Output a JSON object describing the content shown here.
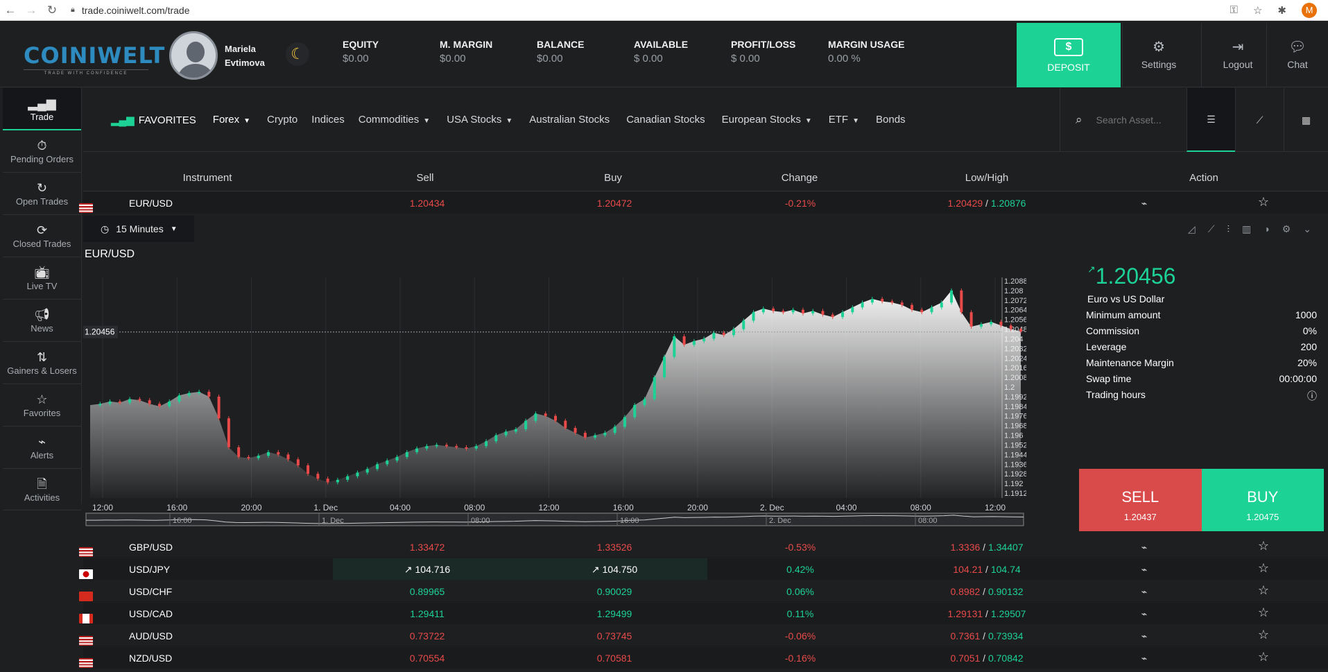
{
  "browser": {
    "url": "trade.coiniwelt.com/trade",
    "profile_letter": "M"
  },
  "header": {
    "logo": "COINIWELT",
    "logo_tagline": "TRADE WITH CONFIDENCE",
    "user_first": "Mariela",
    "user_last": "Evtimova",
    "stats": [
      {
        "label": "EQUITY",
        "value": "$0.00"
      },
      {
        "label": "M. MARGIN",
        "value": "$0.00"
      },
      {
        "label": "BALANCE",
        "value": "$0.00"
      },
      {
        "label": "AVAILABLE",
        "value": "$ 0.00"
      },
      {
        "label": "PROFIT/LOSS",
        "value": "$ 0.00"
      },
      {
        "label": "MARGIN USAGE",
        "value": "0.00 %"
      }
    ],
    "deposit": "DEPOSIT",
    "settings": "Settings",
    "logout": "Logout",
    "chat": "Chat"
  },
  "sidebar": {
    "items": [
      {
        "label": "Trade",
        "icon": "chart-icon"
      },
      {
        "label": "Pending Orders",
        "icon": "stopwatch-icon"
      },
      {
        "label": "Open Trades",
        "icon": "open-trades-icon"
      },
      {
        "label": "Closed Trades",
        "icon": "closed-trades-icon"
      },
      {
        "label": "Live TV",
        "icon": "tv-icon"
      },
      {
        "label": "News",
        "icon": "megaphone-icon"
      },
      {
        "label": "Gainers & Losers",
        "icon": "gainers-icon"
      },
      {
        "label": "Favorites",
        "icon": "star-icon"
      },
      {
        "label": "Alerts",
        "icon": "pulse-icon"
      },
      {
        "label": "Activities",
        "icon": "activities-icon"
      }
    ]
  },
  "categories": {
    "favorites": "FAVORITES",
    "items": [
      {
        "label": "Forex",
        "dropdown": true
      },
      {
        "label": "Crypto",
        "dropdown": false
      },
      {
        "label": "Indices",
        "dropdown": false
      },
      {
        "label": "Commodities",
        "dropdown": true
      },
      {
        "label": "USA Stocks",
        "dropdown": true
      },
      {
        "label": "Australian Stocks",
        "dropdown": false
      },
      {
        "label": "Canadian Stocks",
        "dropdown": false
      },
      {
        "label": "European Stocks",
        "dropdown": true
      },
      {
        "label": "ETF",
        "dropdown": true
      },
      {
        "label": "Bonds",
        "dropdown": false
      }
    ],
    "search_placeholder": "Search Asset..."
  },
  "table": {
    "headers": {
      "instrument": "Instrument",
      "sell": "Sell",
      "buy": "Buy",
      "change": "Change",
      "lowhigh": "Low/High",
      "action": "Action"
    },
    "selected": {
      "symbol": "EUR/USD",
      "sell": "1.20434",
      "buy": "1.20472",
      "change": "-0.21%",
      "low": "1.20429",
      "high": "1.20876"
    },
    "rows": [
      {
        "symbol": "GBP/USD",
        "sell": "1.33472",
        "buy": "1.33526",
        "change": "-0.53%",
        "low": "1.3336",
        "high": "1.34407"
      },
      {
        "symbol": "USD/JPY",
        "sell": "↗ 104.716",
        "buy": "↗ 104.750",
        "change": "0.42%",
        "low": "104.21",
        "high": "104.74"
      },
      {
        "symbol": "USD/CHF",
        "sell": "0.89965",
        "buy": "0.90029",
        "change": "0.06%",
        "low": "0.8982",
        "high": "0.90132"
      },
      {
        "symbol": "USD/CAD",
        "sell": "1.29411",
        "buy": "1.29499",
        "change": "0.11%",
        "low": "1.29131",
        "high": "1.29507"
      },
      {
        "symbol": "AUD/USD",
        "sell": "0.73722",
        "buy": "0.73745",
        "change": "-0.06%",
        "low": "0.7361",
        "high": "0.73934"
      },
      {
        "symbol": "NZD/USD",
        "sell": "0.70554",
        "buy": "0.70581",
        "change": "-0.16%",
        "low": "0.7051",
        "high": "0.70842"
      }
    ]
  },
  "chart_panel": {
    "timeframe": "15 Minutes",
    "title": "EUR/USD",
    "current_price": "1.20456",
    "description": "Euro vs US Dollar",
    "details": [
      {
        "key": "Minimum amount",
        "value": "1000"
      },
      {
        "key": "Commission",
        "value": "0%"
      },
      {
        "key": "Leverage",
        "value": "200"
      },
      {
        "key": "Maintenance Margin",
        "value": "20%"
      },
      {
        "key": "Swap time",
        "value": "00:00:00"
      },
      {
        "key": "Trading hours",
        "value": "ⓘ"
      }
    ],
    "sell_label": "SELL",
    "sell_price": "1.20437",
    "buy_label": "BUY",
    "buy_price": "1.20475"
  },
  "chart_data": {
    "type": "line",
    "x_ticks": [
      "12:00",
      "16:00",
      "20:00",
      "1. Dec",
      "04:00",
      "08:00",
      "12:00",
      "16:00",
      "20:00",
      "2. Dec",
      "04:00",
      "08:00",
      "12:00"
    ],
    "navigator_ticks": [
      "16:00",
      "1. Dec",
      "08:00",
      "16:00",
      "2. Dec",
      "08:00"
    ],
    "y_ticks": [
      "1.2088",
      "1.208",
      "1.2072",
      "1.2064",
      "1.2056",
      "1.2048",
      "1.204",
      "1.2032",
      "1.2024",
      "1.2016",
      "1.2008",
      "1.2",
      "1.1992",
      "1.1984",
      "1.1976",
      "1.1968",
      "1.196",
      "1.1952",
      "1.1944",
      "1.1936",
      "1.1928",
      "1.192",
      "1.1912"
    ],
    "ylim": [
      1.1908,
      1.2092
    ],
    "current_label": "1.20456",
    "current_value": 1.20456,
    "values": [
      1.1985,
      1.1986,
      1.1988,
      1.1987,
      1.199,
      1.1989,
      1.1986,
      1.1984,
      1.1988,
      1.1993,
      1.1995,
      1.1996,
      1.1992,
      1.1974,
      1.195,
      1.1942,
      1.1941,
      1.1943,
      1.1946,
      1.1944,
      1.194,
      1.1935,
      1.1928,
      1.1924,
      1.1921,
      1.1923,
      1.1926,
      1.1929,
      1.1932,
      1.1936,
      1.1939,
      1.1942,
      1.1946,
      1.1949,
      1.1951,
      1.1952,
      1.1951,
      1.195,
      1.1949,
      1.1951,
      1.1955,
      1.196,
      1.1963,
      1.1965,
      1.1972,
      1.1978,
      1.1976,
      1.1972,
      1.1966,
      1.1962,
      1.1958,
      1.196,
      1.1962,
      1.1967,
      1.1975,
      1.1985,
      1.199,
      1.2008,
      1.2025,
      1.2042,
      1.2035,
      1.2038,
      1.204,
      1.2045,
      1.2043,
      1.2048,
      1.2055,
      1.2062,
      1.2065,
      1.2063,
      1.2062,
      1.2064,
      1.2061,
      1.2063,
      1.206,
      1.2058,
      1.2062,
      1.2066,
      1.207,
      1.2073,
      1.2071,
      1.207,
      1.2068,
      1.2064,
      1.2062,
      1.2066,
      1.207,
      1.208,
      1.2062,
      1.205,
      1.2052,
      1.2054,
      1.2051,
      1.2048,
      1.2046
    ]
  }
}
